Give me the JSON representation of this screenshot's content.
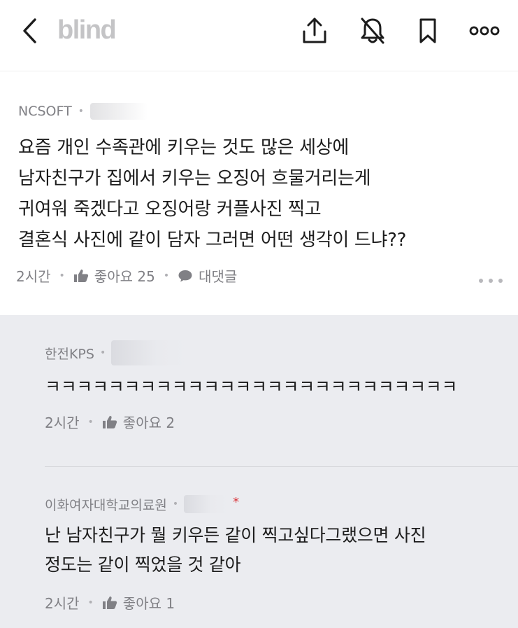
{
  "header": {
    "logo": "blind"
  },
  "post": {
    "company": "NCSOFT",
    "lines": [
      "요즘 개인 수족관에 키우는 것도 많은 세상에",
      "남자친구가 집에서 키우는 오징어 흐물거리는게",
      "귀여워 죽겠다고 오징어랑 커플사진 찍고",
      "결혼식 사진에 같이 담자 그러면 어떤 생각이 드냐??"
    ],
    "time": "2시간",
    "likes": "좋아요 25",
    "comments": "대댓글"
  },
  "comments": [
    {
      "company": "한전KPS",
      "lines": [
        "ㅋㅋㅋㅋㅋㅋㅋㅋㅋㅋㅋㅋㅋㅋㅋㅋㅋㅋㅋㅋㅋㅋㅋㅋㅋㅋ"
      ],
      "time": "2시간",
      "likes": "좋아요 2"
    },
    {
      "company": "이화여자대학교의료원",
      "lines": [
        "난 남자친구가 뭘 키우든 같이 찍고싶다그랬으면 사진",
        "정도는 같이 찍었을 것 같아"
      ],
      "time": "2시간",
      "likes": "좋아요 1",
      "author_marker": "*"
    }
  ],
  "colors": {
    "comment_bg": "#ebecf0",
    "muted": "#808085",
    "author_marker": "#d9343a"
  }
}
